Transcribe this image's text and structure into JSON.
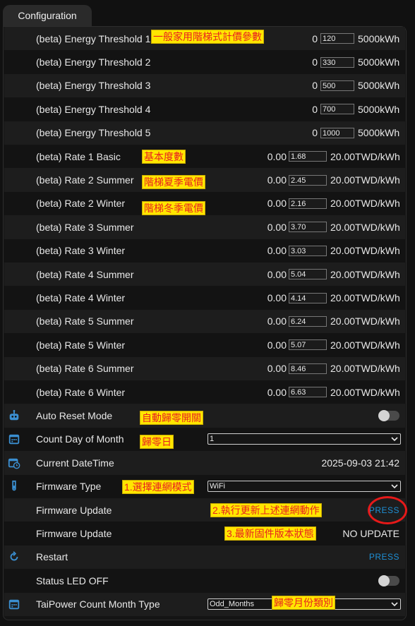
{
  "tab_label": "Configuration",
  "colors": {
    "accent": "#1e90d6",
    "annotation_bg": "#ffe600",
    "annotation_text": "#e82020",
    "highlight_circle": "#e61919"
  },
  "thresholds": [
    {
      "label": "(beta) Energy Threshold 1",
      "min": "0",
      "value": "120",
      "max": "5000kWh"
    },
    {
      "label": "(beta) Energy Threshold 2",
      "min": "0",
      "value": "330",
      "max": "5000kWh"
    },
    {
      "label": "(beta) Energy Threshold 3",
      "min": "0",
      "value": "500",
      "max": "5000kWh"
    },
    {
      "label": "(beta) Energy Threshold 4",
      "min": "0",
      "value": "700",
      "max": "5000kWh"
    },
    {
      "label": "(beta) Energy Threshold 5",
      "min": "0",
      "value": "1000",
      "max": "5000kWh"
    }
  ],
  "rates": [
    {
      "label": "(beta) Rate 1 Basic",
      "min": "0.00",
      "value": "1.68",
      "max": "20.00TWD/kWh"
    },
    {
      "label": "(beta) Rate 2 Summer",
      "min": "0.00",
      "value": "2.45",
      "max": "20.00TWD/kWh"
    },
    {
      "label": "(beta) Rate 2 Winter",
      "min": "0.00",
      "value": "2.16",
      "max": "20.00TWD/kWh"
    },
    {
      "label": "(beta) Rate 3 Summer",
      "min": "0.00",
      "value": "3.70",
      "max": "20.00TWD/kWh"
    },
    {
      "label": "(beta) Rate 3 Winter",
      "min": "0.00",
      "value": "3.03",
      "max": "20.00TWD/kWh"
    },
    {
      "label": "(beta) Rate 4 Summer",
      "min": "0.00",
      "value": "5.04",
      "max": "20.00TWD/kWh"
    },
    {
      "label": "(beta) Rate 4 Winter",
      "min": "0.00",
      "value": "4.14",
      "max": "20.00TWD/kWh"
    },
    {
      "label": "(beta) Rate 5 Summer",
      "min": "0.00",
      "value": "6.24",
      "max": "20.00TWD/kWh"
    },
    {
      "label": "(beta) Rate 5 Winter",
      "min": "0.00",
      "value": "5.07",
      "max": "20.00TWD/kWh"
    },
    {
      "label": "(beta) Rate 6 Summer",
      "min": "0.00",
      "value": "8.46",
      "max": "20.00TWD/kWh"
    },
    {
      "label": "(beta) Rate 6 Winter",
      "min": "0.00",
      "value": "6.63",
      "max": "20.00TWD/kWh"
    }
  ],
  "auto_reset": {
    "label": "Auto Reset Mode",
    "on": false,
    "icon": "robot-icon"
  },
  "count_day": {
    "label": "Count Day of Month",
    "value": "1",
    "icon": "calendar-icon"
  },
  "current_datetime": {
    "label": "Current DateTime",
    "value": "2025-09-03 21:42",
    "icon": "calendar-clock-icon"
  },
  "firmware_type": {
    "label": "Firmware Type",
    "value": "WiFi",
    "icon": "test-tube-icon"
  },
  "firmware_update_press": {
    "label": "Firmware Update",
    "action": "PRESS"
  },
  "firmware_update_status": {
    "label": "Firmware Update",
    "value": "NO UPDATE"
  },
  "restart": {
    "label": "Restart",
    "action": "PRESS",
    "icon": "restart-icon"
  },
  "status_led": {
    "label": "Status LED OFF",
    "on": false
  },
  "taipower_month": {
    "label": "TaiPower Count Month Type",
    "value": "Odd_Months",
    "icon": "calendar-icon"
  },
  "annotations": {
    "threshold": "一般家用階梯式計價參數",
    "basic": "基本度數",
    "summer": "階梯夏季電價",
    "winter": "階梯冬季電價",
    "auto_reset": "自動歸零開關",
    "reset_day": "歸零日",
    "mode": "1.選擇連網模式",
    "update": "2.執行更新上述連網動作",
    "status": "3.最新固件版本狀態",
    "month_type": "歸零月份類別"
  }
}
